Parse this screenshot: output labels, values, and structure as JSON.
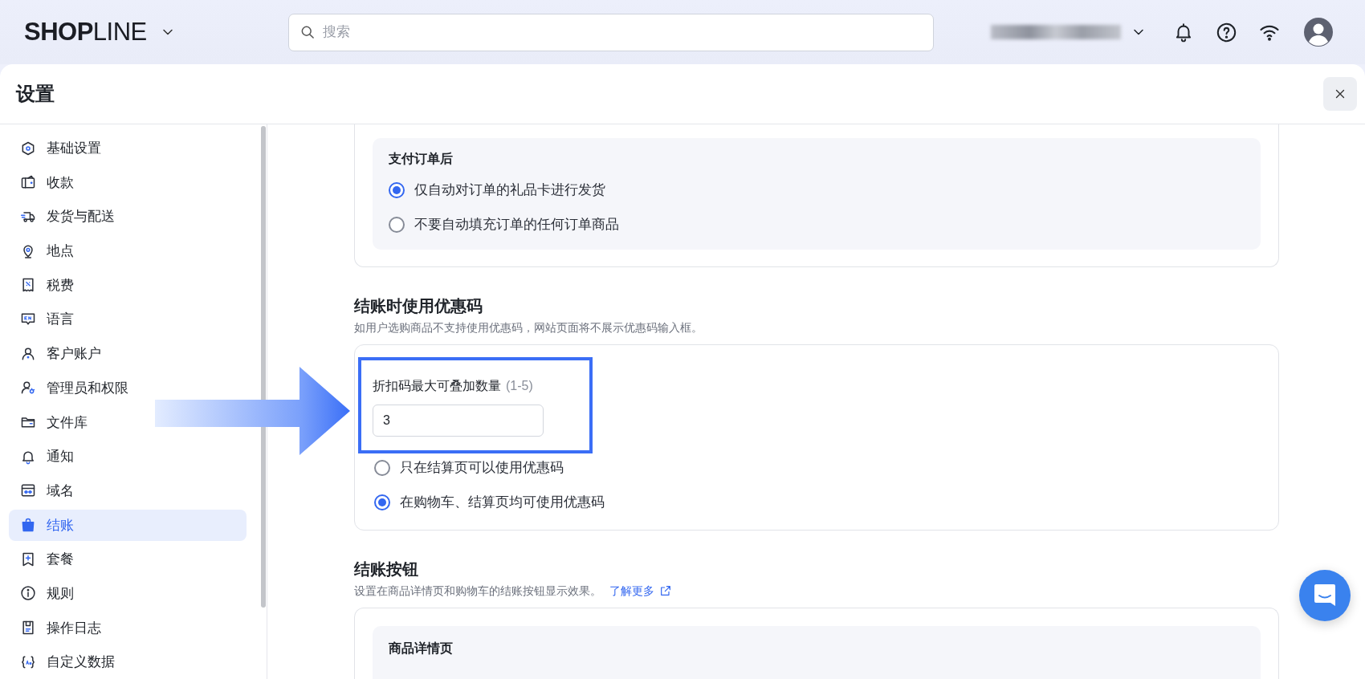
{
  "topbar": {
    "logo": {
      "bold": "SHOP",
      "light": "LINE"
    },
    "search": {
      "placeholder": "搜索"
    }
  },
  "panel": {
    "title": "设置"
  },
  "sidebar": {
    "items": [
      {
        "label": "基础设置",
        "selected": false
      },
      {
        "label": "收款",
        "selected": false
      },
      {
        "label": "发货与配送",
        "selected": false
      },
      {
        "label": "地点",
        "selected": false
      },
      {
        "label": "税费",
        "selected": false
      },
      {
        "label": "语言",
        "selected": false
      },
      {
        "label": "客户账户",
        "selected": false
      },
      {
        "label": "管理员和权限",
        "selected": false
      },
      {
        "label": "文件库",
        "selected": false
      },
      {
        "label": "通知",
        "selected": false
      },
      {
        "label": "域名",
        "selected": false
      },
      {
        "label": "结账",
        "selected": true
      },
      {
        "label": "套餐",
        "selected": false
      },
      {
        "label": "规则",
        "selected": false
      },
      {
        "label": "操作日志",
        "selected": false
      },
      {
        "label": "自定义数据",
        "selected": false
      }
    ]
  },
  "fulfillment_card": {
    "group_title": "支付订单后",
    "options": [
      {
        "label": "仅自动对订单的礼品卡进行发货",
        "selected": true
      },
      {
        "label": "不要自动填充订单的任何订单商品",
        "selected": false
      }
    ]
  },
  "discount_section": {
    "title": "结账时使用优惠码",
    "subtitle": "如用户选购商品不支持使用优惠码，网站页面将不展示优惠码输入框。",
    "field": {
      "label": "折扣码最大可叠加数量",
      "hint": "(1-5)",
      "value": "3"
    },
    "options": [
      {
        "label": "只在结算页可以使用优惠码",
        "selected": false
      },
      {
        "label": "在购物车、结算页均可使用优惠码",
        "selected": true
      }
    ]
  },
  "checkout_button_section": {
    "title": "结账按钮",
    "subtitle": "设置在商品详情页和购物车的结账按钮显示效果。",
    "link": "了解更多",
    "group_title": "商品详情页"
  }
}
